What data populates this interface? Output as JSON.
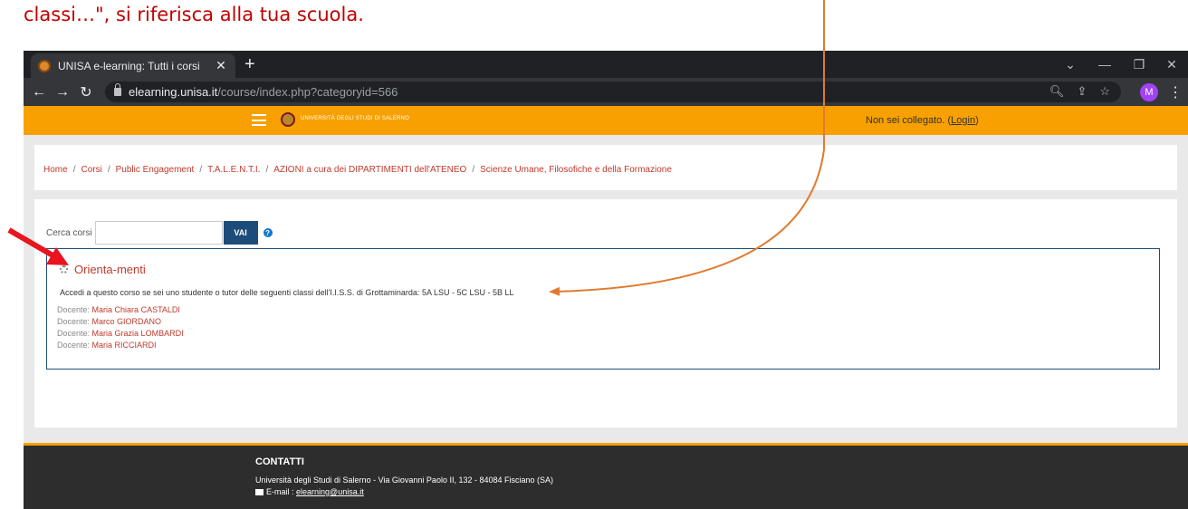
{
  "caption": "classi…\", si riferisca alla tua scuola.",
  "browser": {
    "tab_title": "UNISA e-learning: Tutti i corsi",
    "url_host": "elearning.unisa.it",
    "url_path": "/course/index.php?categoryid=566",
    "profile_initial": "M"
  },
  "header": {
    "logo_text": "UNIVERSITÀ DEGLI STUDI DI SALERNO",
    "login_prefix": "Non sei collegato. (",
    "login_link": "Login",
    "login_suffix": ")"
  },
  "breadcrumb": [
    "Home",
    "Corsi",
    "Public Engagement",
    "T.A.L.E.N.T.I.",
    "AZIONI a cura dei DIPARTIMENTI dell'ATENEO",
    "Scienze Umane, Filosofiche e della Formazione"
  ],
  "search": {
    "label": "Cerca corsi",
    "value": "",
    "button": "VAI"
  },
  "course": {
    "title": "Orienta-menti",
    "summary": "Accedi a questo corso se sei uno studente o tutor delle seguenti classi dell'I.I.S.S. di Grottaminarda: 5A LSU - 5C LSU - 5B LL",
    "teacher_role": "Docente:",
    "teachers": [
      "Maria Chiara CASTALDI",
      "Marco GIORDANO",
      "Maria Grazia LOMBARDI",
      "Maria RICCIARDI"
    ]
  },
  "footer": {
    "title": "CONTATTI",
    "address": "Università degli Studi di Salerno - Via Giovanni Paolo II, 132 - 84084 Fisciano (SA)",
    "email_label": "E-mail :",
    "email": "elearning@unisa.it"
  },
  "colors": {
    "accent_orange": "#f7a000",
    "link_red": "#c0392b",
    "button_blue": "#1d4c7a",
    "annotation_red": "#e8141e",
    "annotation_orange": "#e07a2f"
  }
}
